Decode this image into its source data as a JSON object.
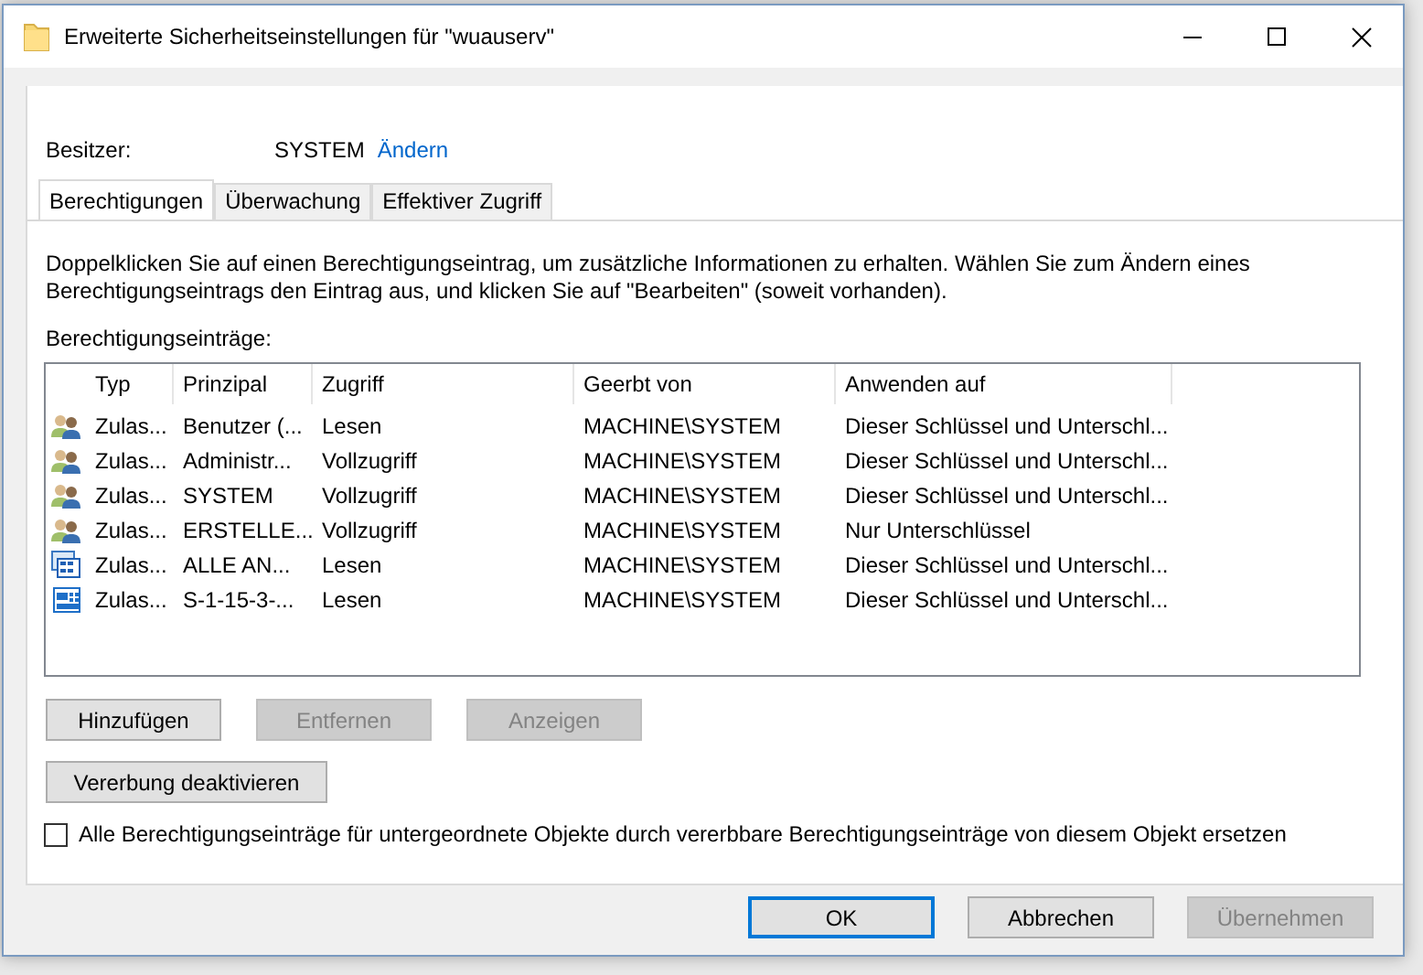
{
  "window": {
    "title": "Erweiterte Sicherheitseinstellungen für \"wuauserv\""
  },
  "owner": {
    "label": "Besitzer:",
    "value": "SYSTEM",
    "link": "Ändern"
  },
  "tabs": [
    {
      "label": "Berechtigungen",
      "selected": true
    },
    {
      "label": "Überwachung",
      "selected": false
    },
    {
      "label": "Effektiver Zugriff",
      "selected": false
    }
  ],
  "description": "Doppelklicken Sie auf einen Berechtigungseintrag, um zusätzliche Informationen zu erhalten. Wählen Sie zum Ändern eines Berechtigungseintrags den Eintrag aus, und klicken Sie auf \"Bearbeiten\" (soweit vorhanden).",
  "entries_label": "Berechtigungseinträge:",
  "table": {
    "columns": [
      "Typ",
      "Prinzipal",
      "Zugriff",
      "Geerbt von",
      "Anwenden auf"
    ],
    "rows": [
      {
        "kind": "group",
        "cells": [
          "Zulas...",
          "Benutzer (...",
          "Lesen",
          "MACHINE\\SYSTEM",
          "Dieser Schlüssel und Unterschl..."
        ]
      },
      {
        "kind": "group",
        "cells": [
          "Zulas...",
          "Administr...",
          "Vollzugriff",
          "MACHINE\\SYSTEM",
          "Dieser Schlüssel und Unterschl..."
        ]
      },
      {
        "kind": "group",
        "cells": [
          "Zulas...",
          "SYSTEM",
          "Vollzugriff",
          "MACHINE\\SYSTEM",
          "Dieser Schlüssel und Unterschl..."
        ]
      },
      {
        "kind": "group",
        "cells": [
          "Zulas...",
          "ERSTELLE...",
          "Vollzugriff",
          "MACHINE\\SYSTEM",
          "Nur Unterschlüssel"
        ]
      },
      {
        "kind": "apps",
        "cells": [
          "Zulas...",
          "ALLE AN...",
          "Lesen",
          "MACHINE\\SYSTEM",
          "Dieser Schlüssel und Unterschl..."
        ]
      },
      {
        "kind": "app",
        "cells": [
          "Zulas...",
          "S-1-15-3-...",
          "Lesen",
          "MACHINE\\SYSTEM",
          "Dieser Schlüssel und Unterschl..."
        ]
      }
    ]
  },
  "entry_buttons": [
    {
      "label": "Hinzufügen",
      "disabled": false
    },
    {
      "label": "Entfernen",
      "disabled": true
    },
    {
      "label": "Anzeigen",
      "disabled": true
    }
  ],
  "inheritance_button": {
    "label": "Vererbung deaktivieren"
  },
  "replace_checkbox": {
    "label": "Alle Berechtigungseinträge für untergeordnete Objekte durch vererbbare Berechtigungseinträge von diesem Objekt ersetzen",
    "checked": false
  },
  "dialog_buttons": [
    {
      "label": "OK",
      "disabled": false,
      "default": true
    },
    {
      "label": "Abbrechen",
      "disabled": false,
      "default": false
    },
    {
      "label": "Übernehmen",
      "disabled": true,
      "default": false
    }
  ]
}
